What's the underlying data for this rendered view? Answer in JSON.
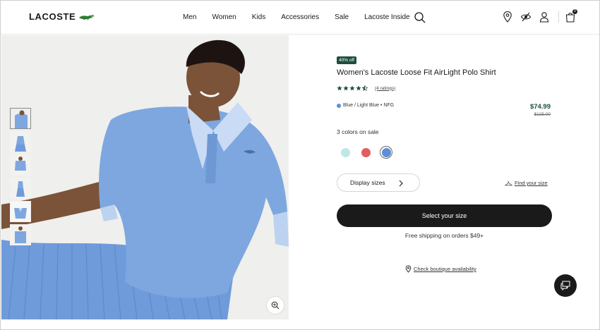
{
  "brand": {
    "name": "LACOSTE",
    "logo_icon": "crocodile-logo"
  },
  "nav": {
    "items": [
      "Men",
      "Women",
      "Kids",
      "Accessories",
      "Sale",
      "Lacoste Inside"
    ],
    "search_icon": "search-icon"
  },
  "header_icons": [
    "store-locator-icon",
    "accessibility-icon",
    "account-icon",
    "cart-icon"
  ],
  "cart": {
    "count": "0"
  },
  "gallery": {
    "thumbnail_count": 6,
    "active_index": 0,
    "zoom_icon": "zoom-in-icon"
  },
  "product": {
    "discount_badge": "40% off",
    "title": "Women's Lacoste Loose Fit AirLight Polo Shirt",
    "rating": 4.5,
    "ratings_label": "(4 ratings)",
    "selected_color": "Blue / Light Blue • NFG",
    "selected_color_hex": "#5a8fd6",
    "price": "$74.99",
    "original_price": "$125.00",
    "colors_on_sale_label": "3 colors on sale",
    "swatches": [
      {
        "hex": "#bde8e6",
        "selected": false
      },
      {
        "hex": "#e25d5e",
        "selected": false
      },
      {
        "hex": "#5d8fd6",
        "selected": true
      }
    ],
    "display_sizes_label": "Display sizes",
    "find_size_label": "Find your size",
    "select_size_label": "Select your size",
    "free_shipping_label": "Free shipping on orders $49+",
    "boutique_label": "Check boutique availability"
  },
  "colors": {
    "accent_green": "#1e4f3e",
    "button_dark": "#1a1a1a",
    "shirt_blue": "#7ea7e0"
  }
}
